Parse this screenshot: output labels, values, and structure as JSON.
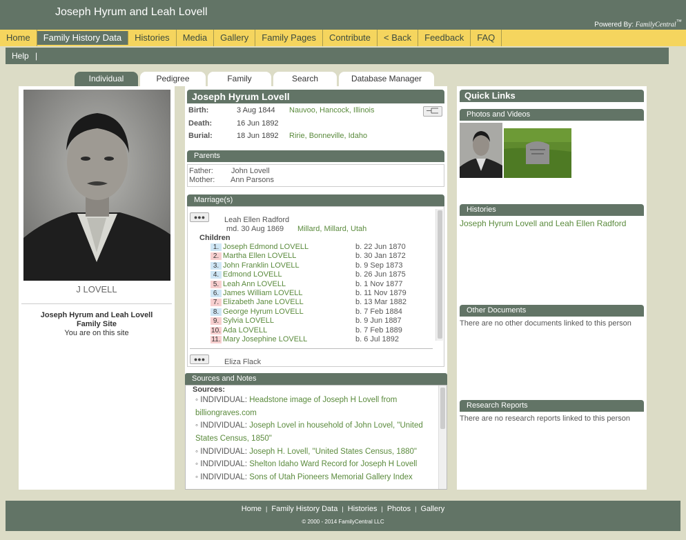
{
  "header": {
    "title": "Joseph Hyrum and Leah Lovell",
    "powered_label": "Powered By:",
    "powered_brand": "FamilyCentral",
    "powered_tm": "™"
  },
  "nav": [
    "Home",
    "Family History Data",
    "Histories",
    "Media",
    "Gallery",
    "Family Pages",
    "Contribute",
    "< Back",
    "Feedback",
    "FAQ"
  ],
  "nav_active": "Family History Data",
  "subnav": {
    "help": "Help",
    "sep": "|"
  },
  "tabs": [
    "Individual",
    "Pedigree",
    "Family",
    "Search",
    "Database Manager"
  ],
  "tab_active": "Individual",
  "left": {
    "photo_caption": "J LOVELL",
    "site_name_line1": "Joseph Hyrum and Leah Lovell",
    "site_name_line2": "Family Site",
    "site_note": "You are on this site"
  },
  "person": {
    "name": "Joseph Hyrum Lovell",
    "facts": [
      {
        "label": "Birth:",
        "date": "3 Aug 1844",
        "place": "Nauvoo, Hancock, Illinois"
      },
      {
        "label": "Death:",
        "date": "16 Jun 1892",
        "place": ""
      },
      {
        "label": "Burial:",
        "date": "18 Jun 1892",
        "place": "Ririe, Bonneville, Idaho"
      }
    ]
  },
  "parents": {
    "header": "Parents",
    "father_label": "Father:",
    "father": "John Lovell",
    "mother_label": "Mother:",
    "mother": "Ann Parsons"
  },
  "marriages": {
    "header": "Marriage(s)",
    "spouse1": "Leah Ellen Radford",
    "married": "md. 30 Aug 1869",
    "married_place": "Millard, Millard, Utah",
    "children_label": "Children",
    "children": [
      {
        "num": "1.",
        "name": "Joseph Edmond LOVELL",
        "birth": "b. 22 Jun 1870",
        "color": "#cfe6f5"
      },
      {
        "num": "2.",
        "name": "Martha Ellen LOVELL",
        "birth": "b. 30 Jan 1872",
        "color": "#f7cfcf"
      },
      {
        "num": "3.",
        "name": "John Franklin LOVELL",
        "birth": "b. 9 Sep 1873",
        "color": "#cfe6f5"
      },
      {
        "num": "4.",
        "name": "Edmond LOVELL",
        "birth": "b. 26 Jun 1875",
        "color": "#cfe6f5"
      },
      {
        "num": "5.",
        "name": "Leah Ann LOVELL",
        "birth": "b. 1 Nov 1877",
        "color": "#f7cfcf"
      },
      {
        "num": "6.",
        "name": "James William LOVELL",
        "birth": "b. 11 Nov 1879",
        "color": "#cfe6f5"
      },
      {
        "num": "7.",
        "name": "Elizabeth Jane LOVELL",
        "birth": "b. 13 Mar 1882",
        "color": "#f7cfcf"
      },
      {
        "num": "8.",
        "name": "George Hyrum LOVELL",
        "birth": "b. 7 Feb 1884",
        "color": "#cfe6f5"
      },
      {
        "num": "9.",
        "name": "Sylvia LOVELL",
        "birth": "b. 9 Jun 1887",
        "color": "#f7cfcf"
      },
      {
        "num": "10.",
        "name": "Ada LOVELL",
        "birth": "b. 7 Feb 1889",
        "color": "#f7cfcf"
      },
      {
        "num": "11.",
        "name": "Mary Josephine LOVELL",
        "birth": "b. 6 Jul 1892",
        "color": "#f7cfcf"
      }
    ],
    "spouse2": "Eliza Flack"
  },
  "sources": {
    "header": "Sources and Notes",
    "label": "Sources:",
    "items": [
      {
        "prefix": "INDIVIDUAL:",
        "text": "Headstone image of Joseph H Lovell from billiongraves.com"
      },
      {
        "prefix": "INDIVIDUAL:",
        "text": "Joseph Lovel in household of John Lovel, \"United States Census, 1850\""
      },
      {
        "prefix": "INDIVIDUAL:",
        "text": "Joseph H. Lovell, \"United States Census, 1880\""
      },
      {
        "prefix": "INDIVIDUAL:",
        "text": "Shelton Idaho Ward Record for Joseph H Lovell"
      },
      {
        "prefix": "INDIVIDUAL:",
        "text": "Sons of Utah Pioneers Memorial Gallery Index"
      }
    ]
  },
  "right": {
    "quick_links": "Quick Links",
    "photos_header": "Photos and Videos",
    "histories_header": "Histories",
    "history_link": "Joseph Hyrum Lovell and Leah Ellen Radford",
    "other_docs_header": "Other Documents",
    "other_docs_text": "There are no other documents linked to this person",
    "research_header": "Research Reports",
    "research_text": "There are no research reports linked to this person"
  },
  "footer": {
    "links": [
      "Home",
      "Family History Data",
      "Histories",
      "Photos",
      "Gallery"
    ],
    "copyright": "© 2000 - 2014 FamilyCentral LLC"
  },
  "colors": {
    "brand": "#627466",
    "nav_bg": "#f5d55e",
    "page_bg": "#dcdcc6",
    "link": "#5a8a3c"
  }
}
